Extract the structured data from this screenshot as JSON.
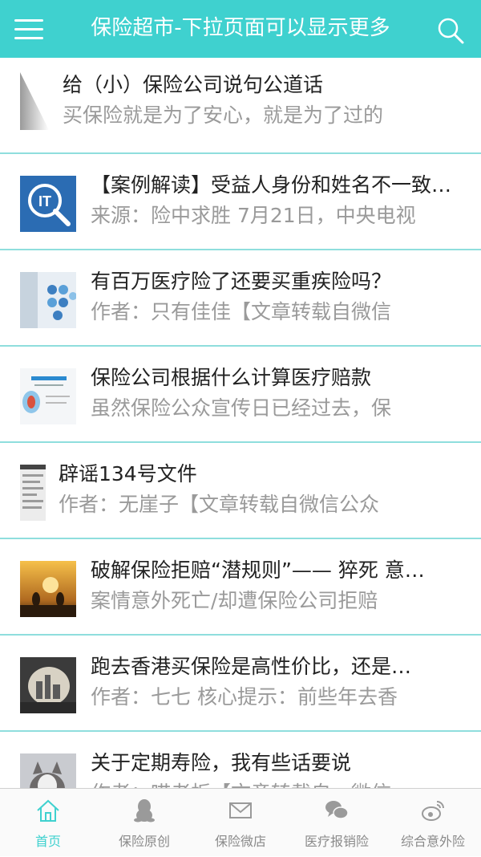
{
  "header": {
    "title": "保险超市-下拉页面可以显示更多",
    "menu_icon": "menu-icon",
    "search_icon": "search-icon"
  },
  "articles": [
    {
      "title": "给（小）保险公司说句公道话",
      "subtitle": "买保险就是为了安心，就是为了过的",
      "thumb": "gradient-thumbnail"
    },
    {
      "title": "【案例解读】受益人身份和姓名不一致…",
      "subtitle": "来源：险中求胜 7月21日，中央电视",
      "thumb": "it-magnifier-thumbnail"
    },
    {
      "title": "有百万医疗险了还要买重疾险吗？",
      "subtitle": "作者：只有佳佳【文章转载自微信",
      "thumb": "medical-thumbnail"
    },
    {
      "title": "保险公司根据什么计算医疗赔款",
      "subtitle": "虽然保险公众宣传日已经过去，保",
      "thumb": "document-thumbnail"
    },
    {
      "title": "辟谣134号文件",
      "subtitle": "作者：无崖子【文章转载自微信公众",
      "thumb": "phone-screenshot-thumbnail"
    },
    {
      "title": "破解保险拒赔“潜规则”—— 猝死 意…",
      "subtitle": "案情意外死亡/却遭保险公司拒赔",
      "thumb": "sunset-thumbnail"
    },
    {
      "title": "跑去香港买保险是高性价比，还是…",
      "subtitle": "作者：七七 核心提示：前些年去香",
      "thumb": "city-thumbnail"
    },
    {
      "title": "关于定期寿险，我有些话要说",
      "subtitle": "作者：喵老板【文章转载自，微信",
      "thumb": "cat-thumbnail"
    }
  ],
  "tabs": [
    {
      "label": "首页",
      "icon": "home-icon",
      "active": true
    },
    {
      "label": "保险原创",
      "icon": "penguin-icon",
      "active": false
    },
    {
      "label": "保险微店",
      "icon": "envelope-icon",
      "active": false
    },
    {
      "label": "医疗报销险",
      "icon": "chat-bubble-icon",
      "active": false
    },
    {
      "label": "综合意外险",
      "icon": "weibo-icon",
      "active": false
    }
  ],
  "colors": {
    "accent": "#3fd1cf",
    "divider": "#8fdedd",
    "text": "#222222",
    "muted": "#9a9a9a"
  }
}
